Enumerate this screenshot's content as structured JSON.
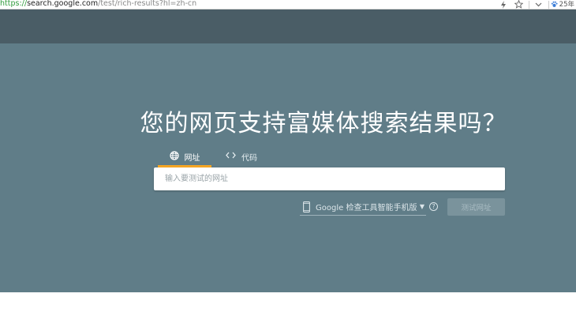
{
  "browser": {
    "url_protocol": "https://",
    "url_host": "search.google.com",
    "url_path": "/test/rich-results?hl=zh-cn",
    "date_badge": "25年"
  },
  "hero": {
    "title": "您的网页支持富媒体搜索结果吗？"
  },
  "tabs": [
    {
      "label": "网址",
      "icon": "globe-icon",
      "selected": true
    },
    {
      "label": "代码",
      "icon": "code-icon",
      "selected": false
    }
  ],
  "url_input": {
    "placeholder": "输入要测试的网址",
    "value": ""
  },
  "device_select": {
    "selected": "Google 检查工具智能手机版"
  },
  "test_button": {
    "label": "测试网址"
  },
  "colors": {
    "header_band": "#4a5d66",
    "hero_bg": "#607d88",
    "tab_indicator": "#f6a623"
  }
}
